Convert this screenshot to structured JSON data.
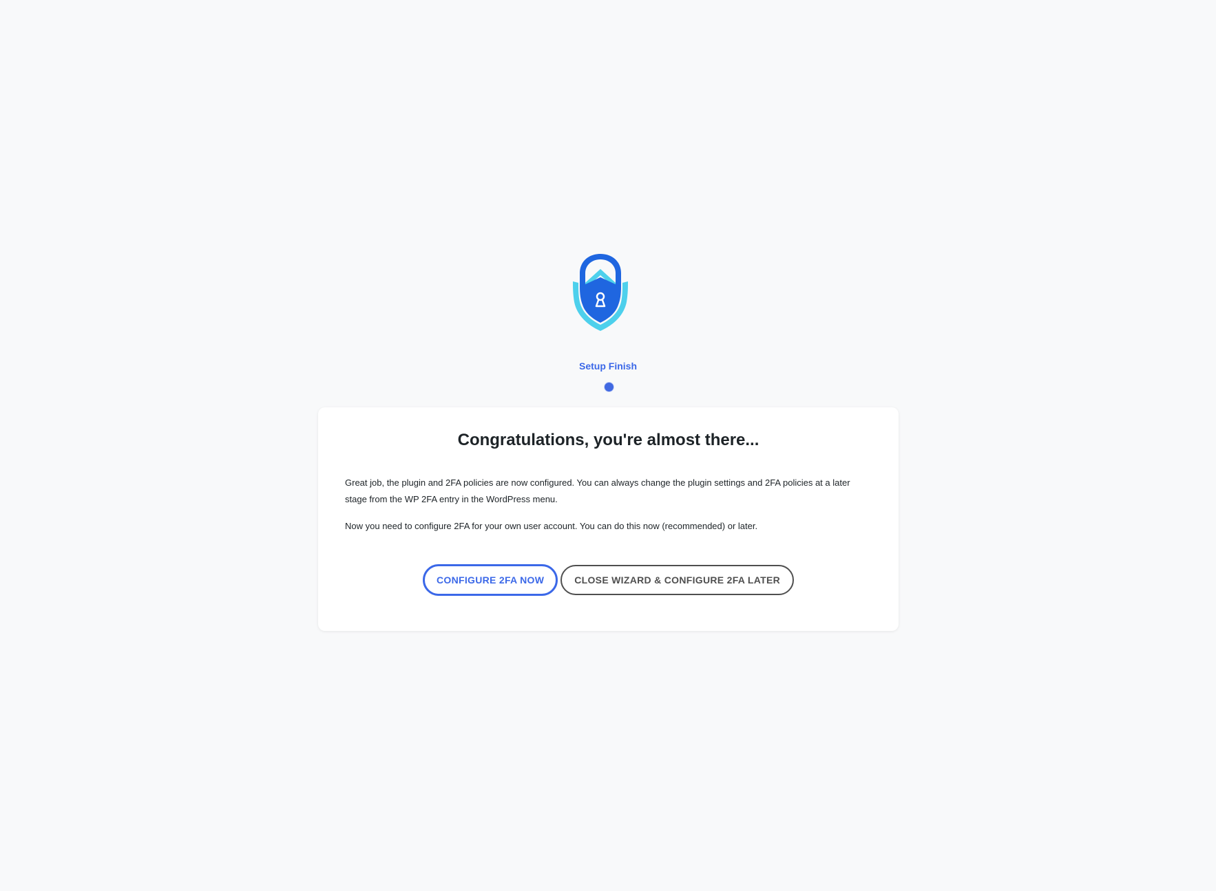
{
  "header": {
    "logo_icon": "shield-lock-icon",
    "step_label": "Setup Finish"
  },
  "card": {
    "title": "Congratulations, you're almost there...",
    "paragraph_1": "Great job, the plugin and 2FA policies are now configured. You can always change the plugin settings and 2FA policies at a later stage from the WP 2FA entry in the WordPress menu.",
    "paragraph_2": "Now you need to configure 2FA for your own user account. You can do this now (recommended) or later.",
    "buttons": {
      "configure_now": "CONFIGURE 2FA NOW",
      "close_wizard": "CLOSE WIZARD & CONFIGURE 2FA LATER"
    }
  },
  "colors": {
    "accent": "#3b68e8",
    "background": "#f8f9fa",
    "card": "#ffffff",
    "secondary_button": "#4f4f4f",
    "shield_outer": "#4dd0ec",
    "shield_inner": "#1f66e0"
  }
}
